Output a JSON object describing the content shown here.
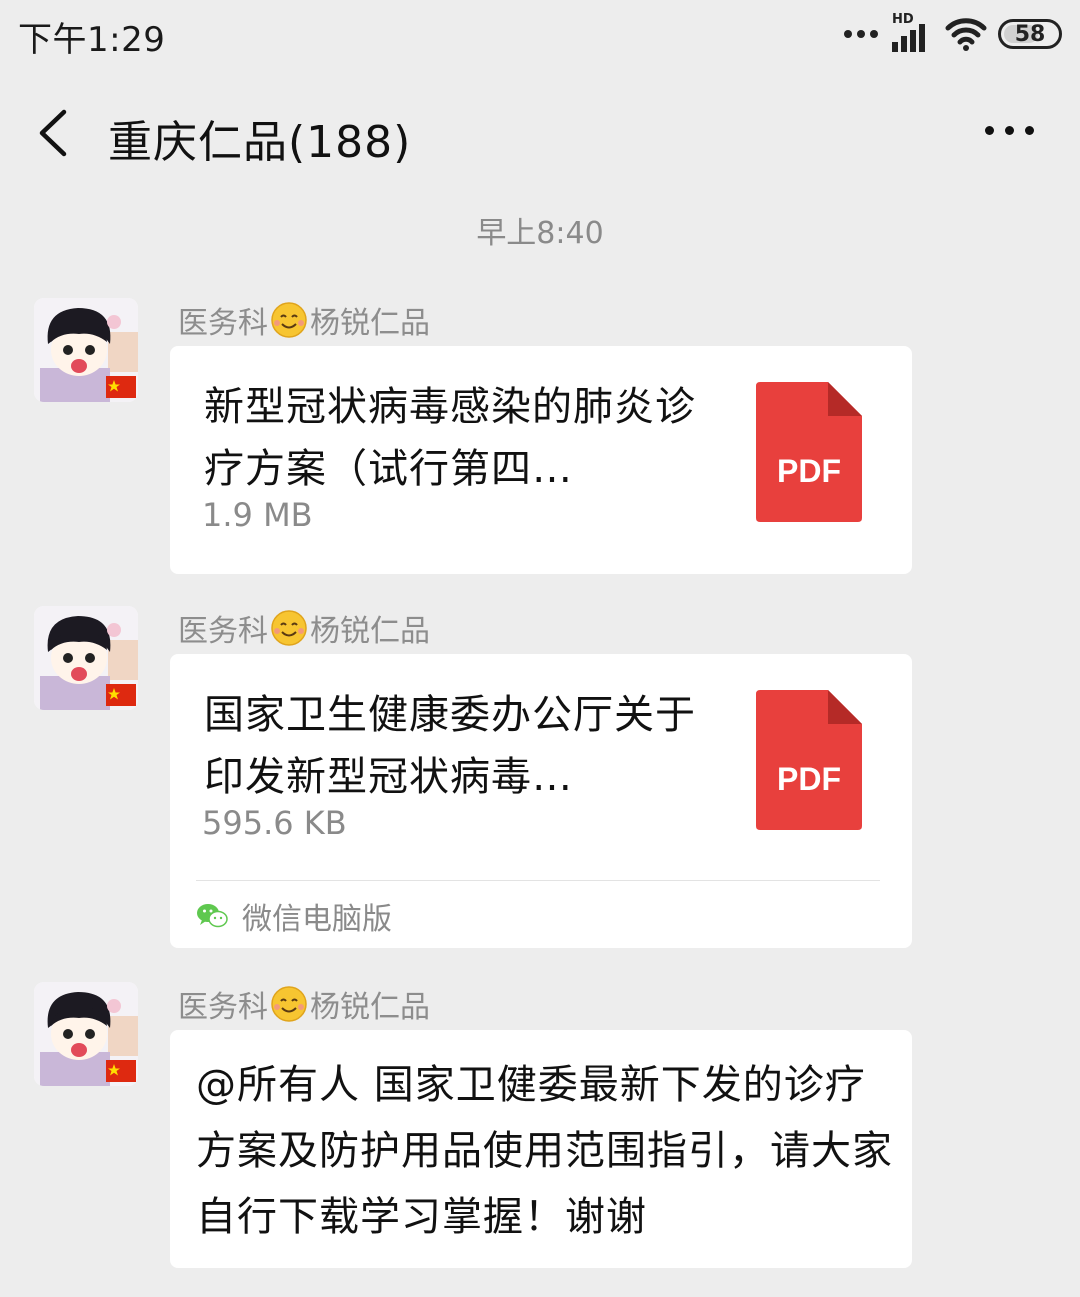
{
  "status_bar": {
    "time": "下午1:29",
    "network_label": "HD",
    "battery": "58"
  },
  "nav": {
    "title": "重庆仁品(188)"
  },
  "timestamp": "早上8:40",
  "sender": {
    "prefix": "医务科",
    "suffix": "杨锐仁品"
  },
  "messages": [
    {
      "type": "file",
      "file_name": "新型冠状病毒感染的肺炎诊疗方案（试行第四…",
      "file_size": "1.9 MB",
      "file_icon_label": "PDF"
    },
    {
      "type": "file",
      "file_name": "国家卫生健康委办公厅关于印发新型冠状病毒…",
      "file_size": "595.6 KB",
      "file_icon_label": "PDF",
      "source": "微信电脑版"
    },
    {
      "type": "text",
      "text": "@所有人 国家卫健委最新下发的诊疗方案及防护用品使用范围指引，请大家自行下载学习掌握！谢谢"
    }
  ],
  "colors": {
    "background": "#ededed",
    "bubble": "#ffffff",
    "pdf_red": "#e8403d",
    "meta_gray": "#8a8a8a",
    "wechat_green": "#5fc84f"
  },
  "icons": {
    "back": "chevron-left-icon",
    "more": "more-dots-icon",
    "file": "pdf-file-icon",
    "source": "wechat-icon",
    "emoji": "smile-emoji-icon",
    "flag": "china-flag-icon"
  }
}
